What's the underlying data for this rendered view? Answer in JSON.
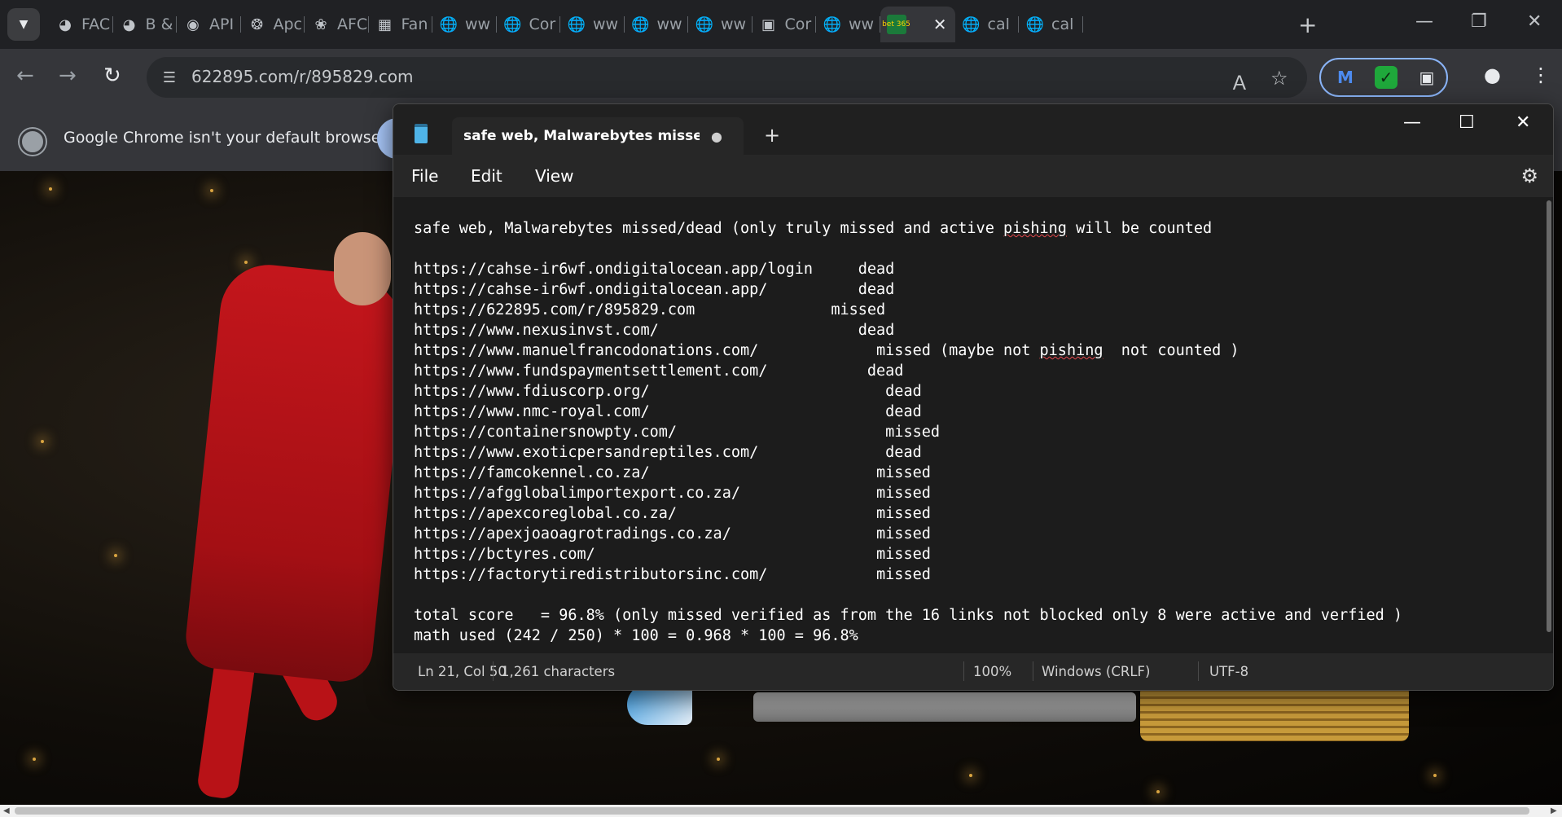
{
  "browser": {
    "tabs": [
      {
        "label": "FAC",
        "icon": "performance-icon"
      },
      {
        "label": "B &",
        "icon": "performance-icon"
      },
      {
        "label": "API",
        "icon": "api-logo-icon"
      },
      {
        "label": "Apc",
        "icon": "apc-logo-icon"
      },
      {
        "label": "AFC",
        "icon": "plant-logo-icon"
      },
      {
        "label": "Fan",
        "icon": "fan-logo-icon"
      },
      {
        "label": "ww",
        "icon": "globe-icon"
      },
      {
        "label": "Cor",
        "icon": "globe-icon"
      },
      {
        "label": "ww",
        "icon": "globe-icon"
      },
      {
        "label": "ww",
        "icon": "globe-icon"
      },
      {
        "label": "ww",
        "icon": "globe-icon"
      },
      {
        "label": "Cor",
        "icon": "cube-icon"
      },
      {
        "label": "ww",
        "icon": "globe-icon"
      },
      {
        "label": "",
        "icon": "bet365-icon",
        "active": true
      },
      {
        "label": "cal",
        "icon": "globe-icon"
      },
      {
        "label": "cal",
        "icon": "globe-icon"
      }
    ],
    "url": "622895.com/r/895829.com",
    "infobar_text": "Google Chrome isn't your default browser",
    "active_tab_badge": "bet 365"
  },
  "notepad": {
    "tab_title": "safe web, Malwarebytes misseddead",
    "menu": [
      "File",
      "Edit",
      "View"
    ],
    "lines": [
      "safe web, Malwarebytes missed/dead (only truly missed and active pishing will be counted",
      "",
      "https://cahse-ir6wf.ondigitalocean.app/login     dead",
      "https://cahse-ir6wf.ondigitalocean.app/          dead",
      "https://622895.com/r/895829.com               missed",
      "https://www.nexusinvst.com/                      dead",
      "https://www.manuelfrancodonations.com/             missed (maybe not pishing  not counted )",
      "https://www.fundspaymentsettlement.com/           dead",
      "https://www.fdiuscorp.org/                          dead",
      "https://www.nmc-royal.com/                          dead",
      "https://containersnowpty.com/                       missed",
      "https://www.exoticpersandreptiles.com/              dead",
      "https://famcokennel.co.za/                         missed",
      "https://afgglobalimportexport.co.za/               missed",
      "https://apexcoreglobal.co.za/                      missed",
      "https://apexjoaoagrotradings.co.za/                missed",
      "https://bctyres.com/                               missed",
      "https://factorytiredistributorsinc.com/            missed",
      "",
      "total score   = 96.8% (only missed verified as from the 16 links not blocked only 8 were active and verfied )",
      "math used (242 / 250) * 100 = 0.968 * 100 = 96.8%"
    ],
    "status": {
      "position": "Ln 21, Col 50",
      "characters": "1,261 characters",
      "zoom": "100%",
      "line_ending": "Windows (CRLF)",
      "encoding": "UTF-8"
    }
  },
  "colors": {
    "chrome_frame": "#202124",
    "chrome_toolbar": "#35363a",
    "notepad_bg": "#1c1c1c",
    "spellcheck": "#e5484d",
    "jersey_red": "#c4161c"
  }
}
